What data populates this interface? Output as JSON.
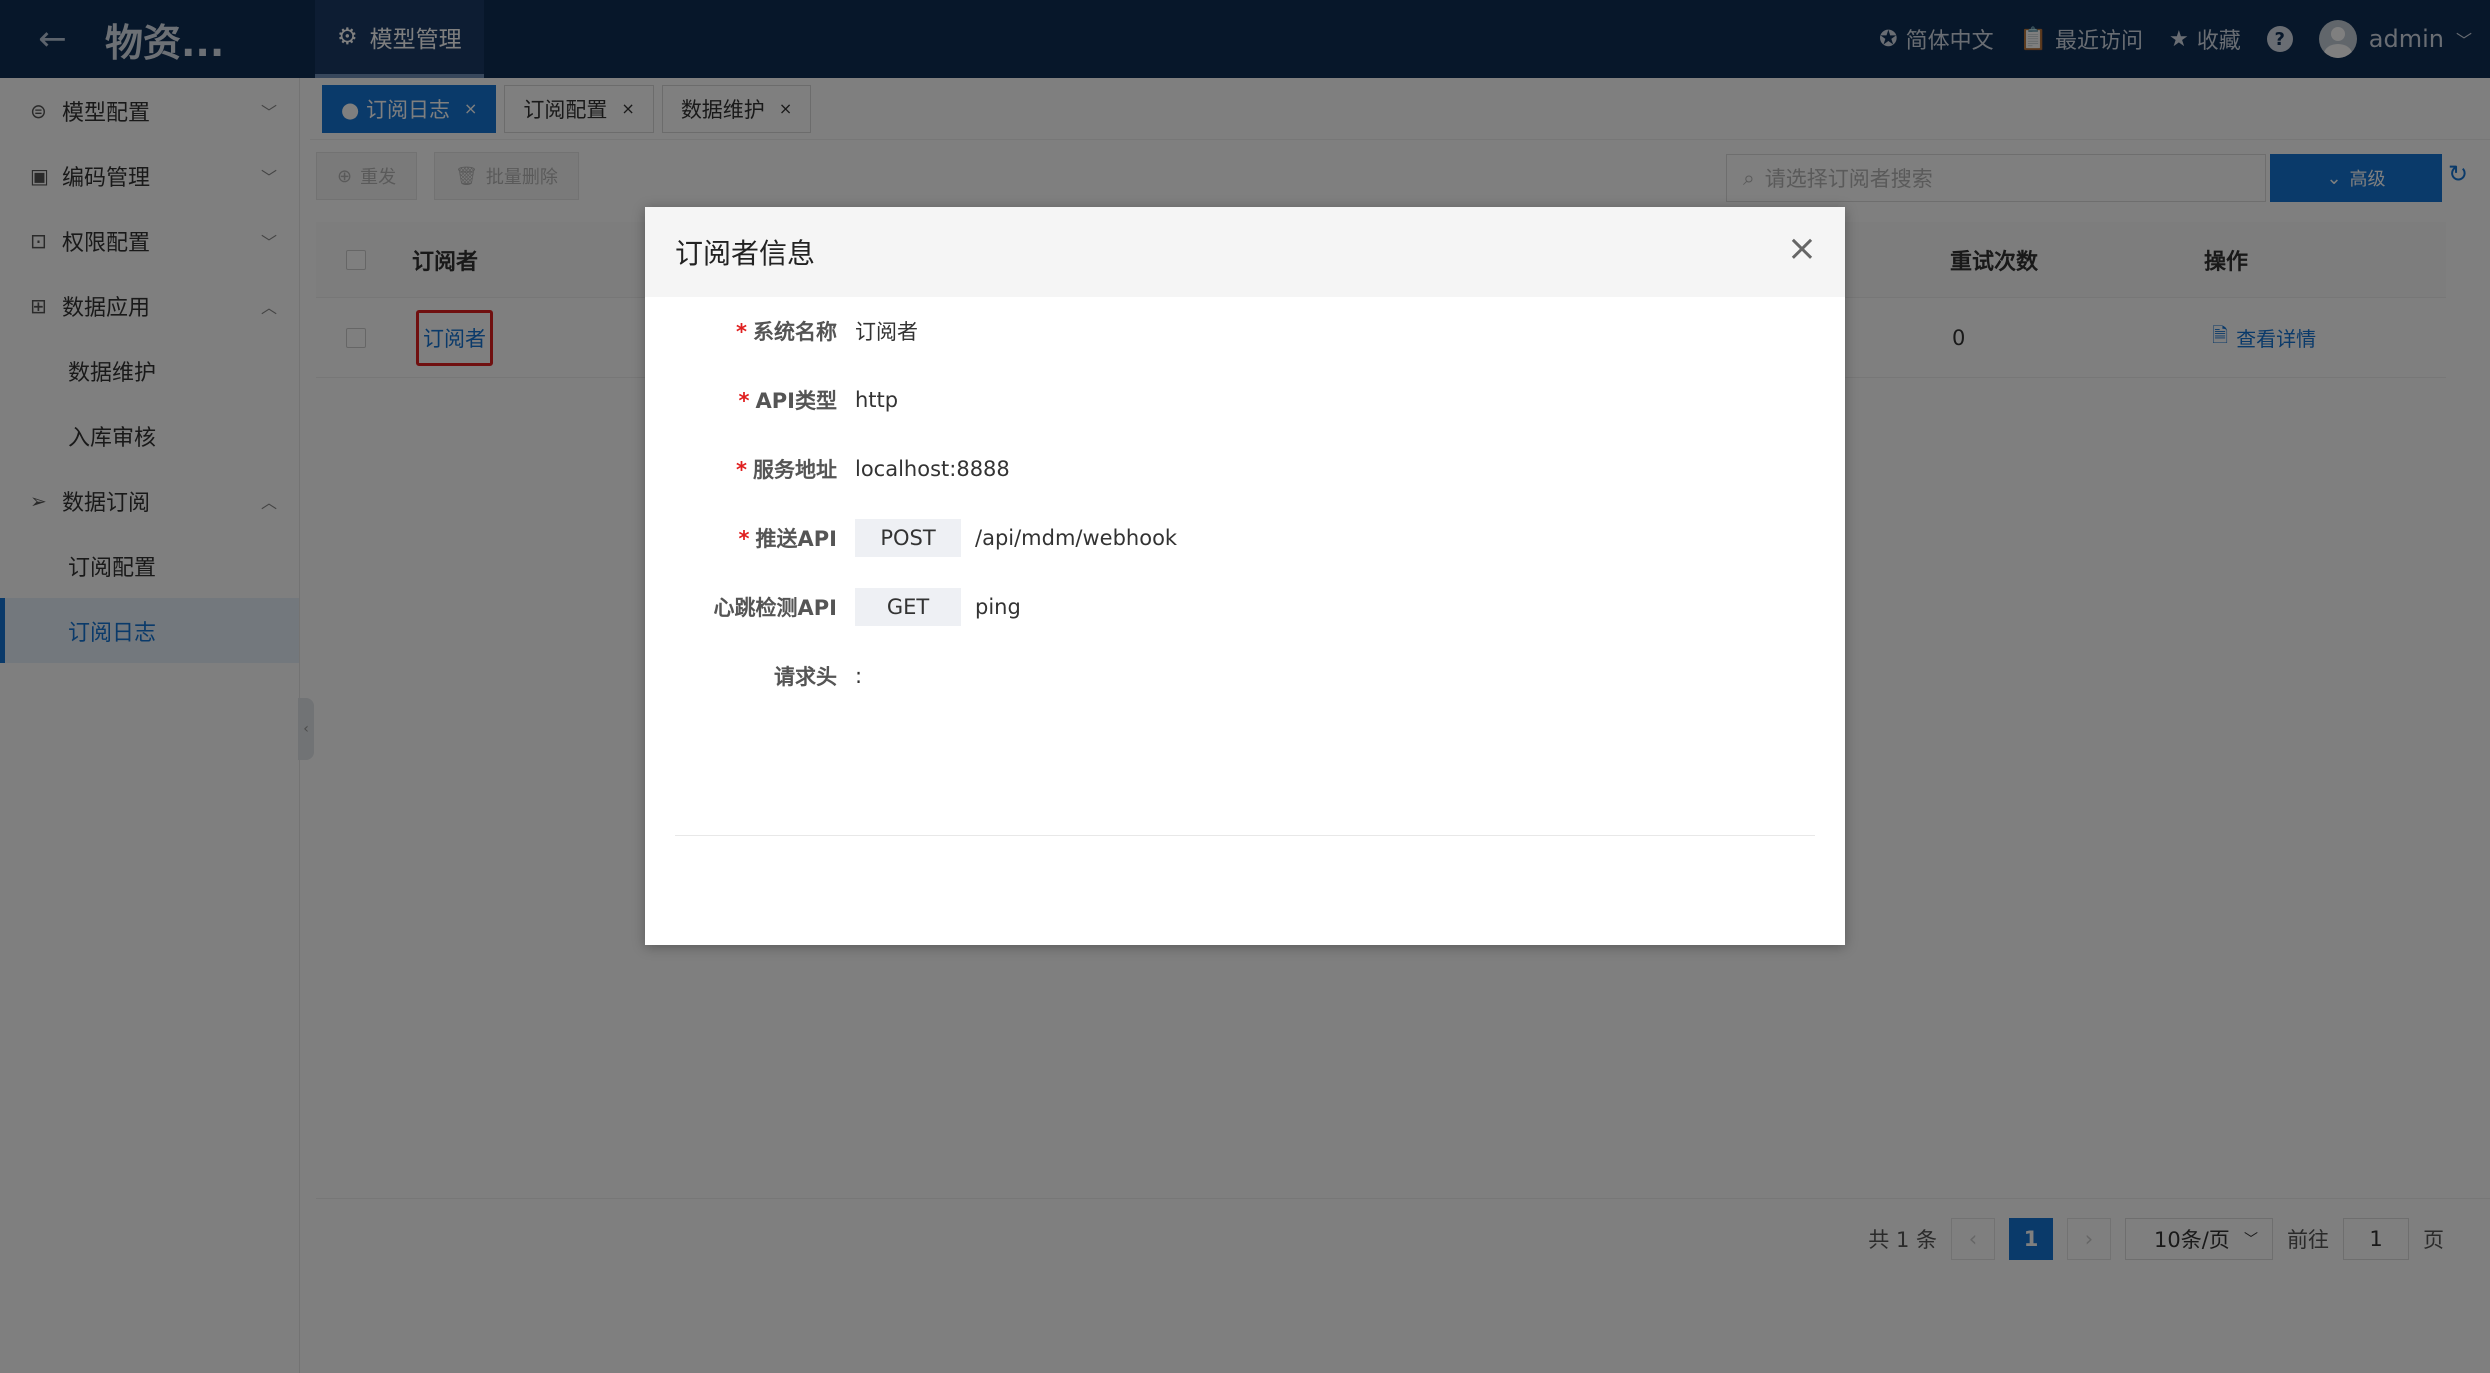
{
  "header": {
    "back_icon": "←",
    "app_title": "物资...",
    "top_tab": "模型管理",
    "language": "简体中文",
    "recent": "最近访问",
    "favorites": "收藏",
    "help": "?",
    "user": "admin"
  },
  "sidebar": {
    "items": [
      {
        "label": "模型配置",
        "icon": "⊜",
        "chev": "﹀"
      },
      {
        "label": "编码管理",
        "icon": "▣",
        "chev": "﹀"
      },
      {
        "label": "权限配置",
        "icon": "⊡",
        "chev": "﹀"
      },
      {
        "label": "数据应用",
        "icon": "⊞",
        "chev": "︿"
      },
      {
        "label": "数据维护"
      },
      {
        "label": "入库审核"
      },
      {
        "label": "数据订阅",
        "icon": "➢",
        "chev": "︿"
      },
      {
        "label": "订阅配置"
      },
      {
        "label": "订阅日志"
      }
    ]
  },
  "page_tabs": [
    {
      "label": "● 订阅日志",
      "close": "×"
    },
    {
      "label": "订阅配置",
      "close": "×"
    },
    {
      "label": "数据维护",
      "close": "×"
    }
  ],
  "toolbar": {
    "resend": "重发",
    "batch_delete": "批量删除",
    "search_placeholder": "请选择订阅者搜索",
    "advanced": "高级"
  },
  "table": {
    "headers": {
      "subscriber": "订阅者",
      "retries": "重试次数",
      "actions": "操作"
    },
    "rows": [
      {
        "subscriber": "订阅者",
        "retries": "0",
        "action": "查看详情"
      }
    ]
  },
  "pagination": {
    "total": "共 1 条",
    "prev": "‹",
    "current": "1",
    "next": "›",
    "page_size": "10条/页",
    "goto_label": "前往",
    "goto_value": "1",
    "page_suffix": "页"
  },
  "modal": {
    "title": "订阅者信息",
    "close": "×",
    "fields": {
      "system_name": {
        "label": "系统名称",
        "value": "订阅者",
        "required": "*"
      },
      "api_type": {
        "label": "API类型",
        "value": "http",
        "required": "*"
      },
      "service_url": {
        "label": "服务地址",
        "value": "localhost:8888",
        "required": "*"
      },
      "push_api": {
        "label": "推送API",
        "method": "POST",
        "value": "/api/mdm/webhook",
        "required": "*"
      },
      "heartbeat_api": {
        "label": "心跳检测API",
        "method": "GET",
        "value": "ping"
      },
      "headers": {
        "label": "请求头",
        "value": ":"
      }
    }
  }
}
